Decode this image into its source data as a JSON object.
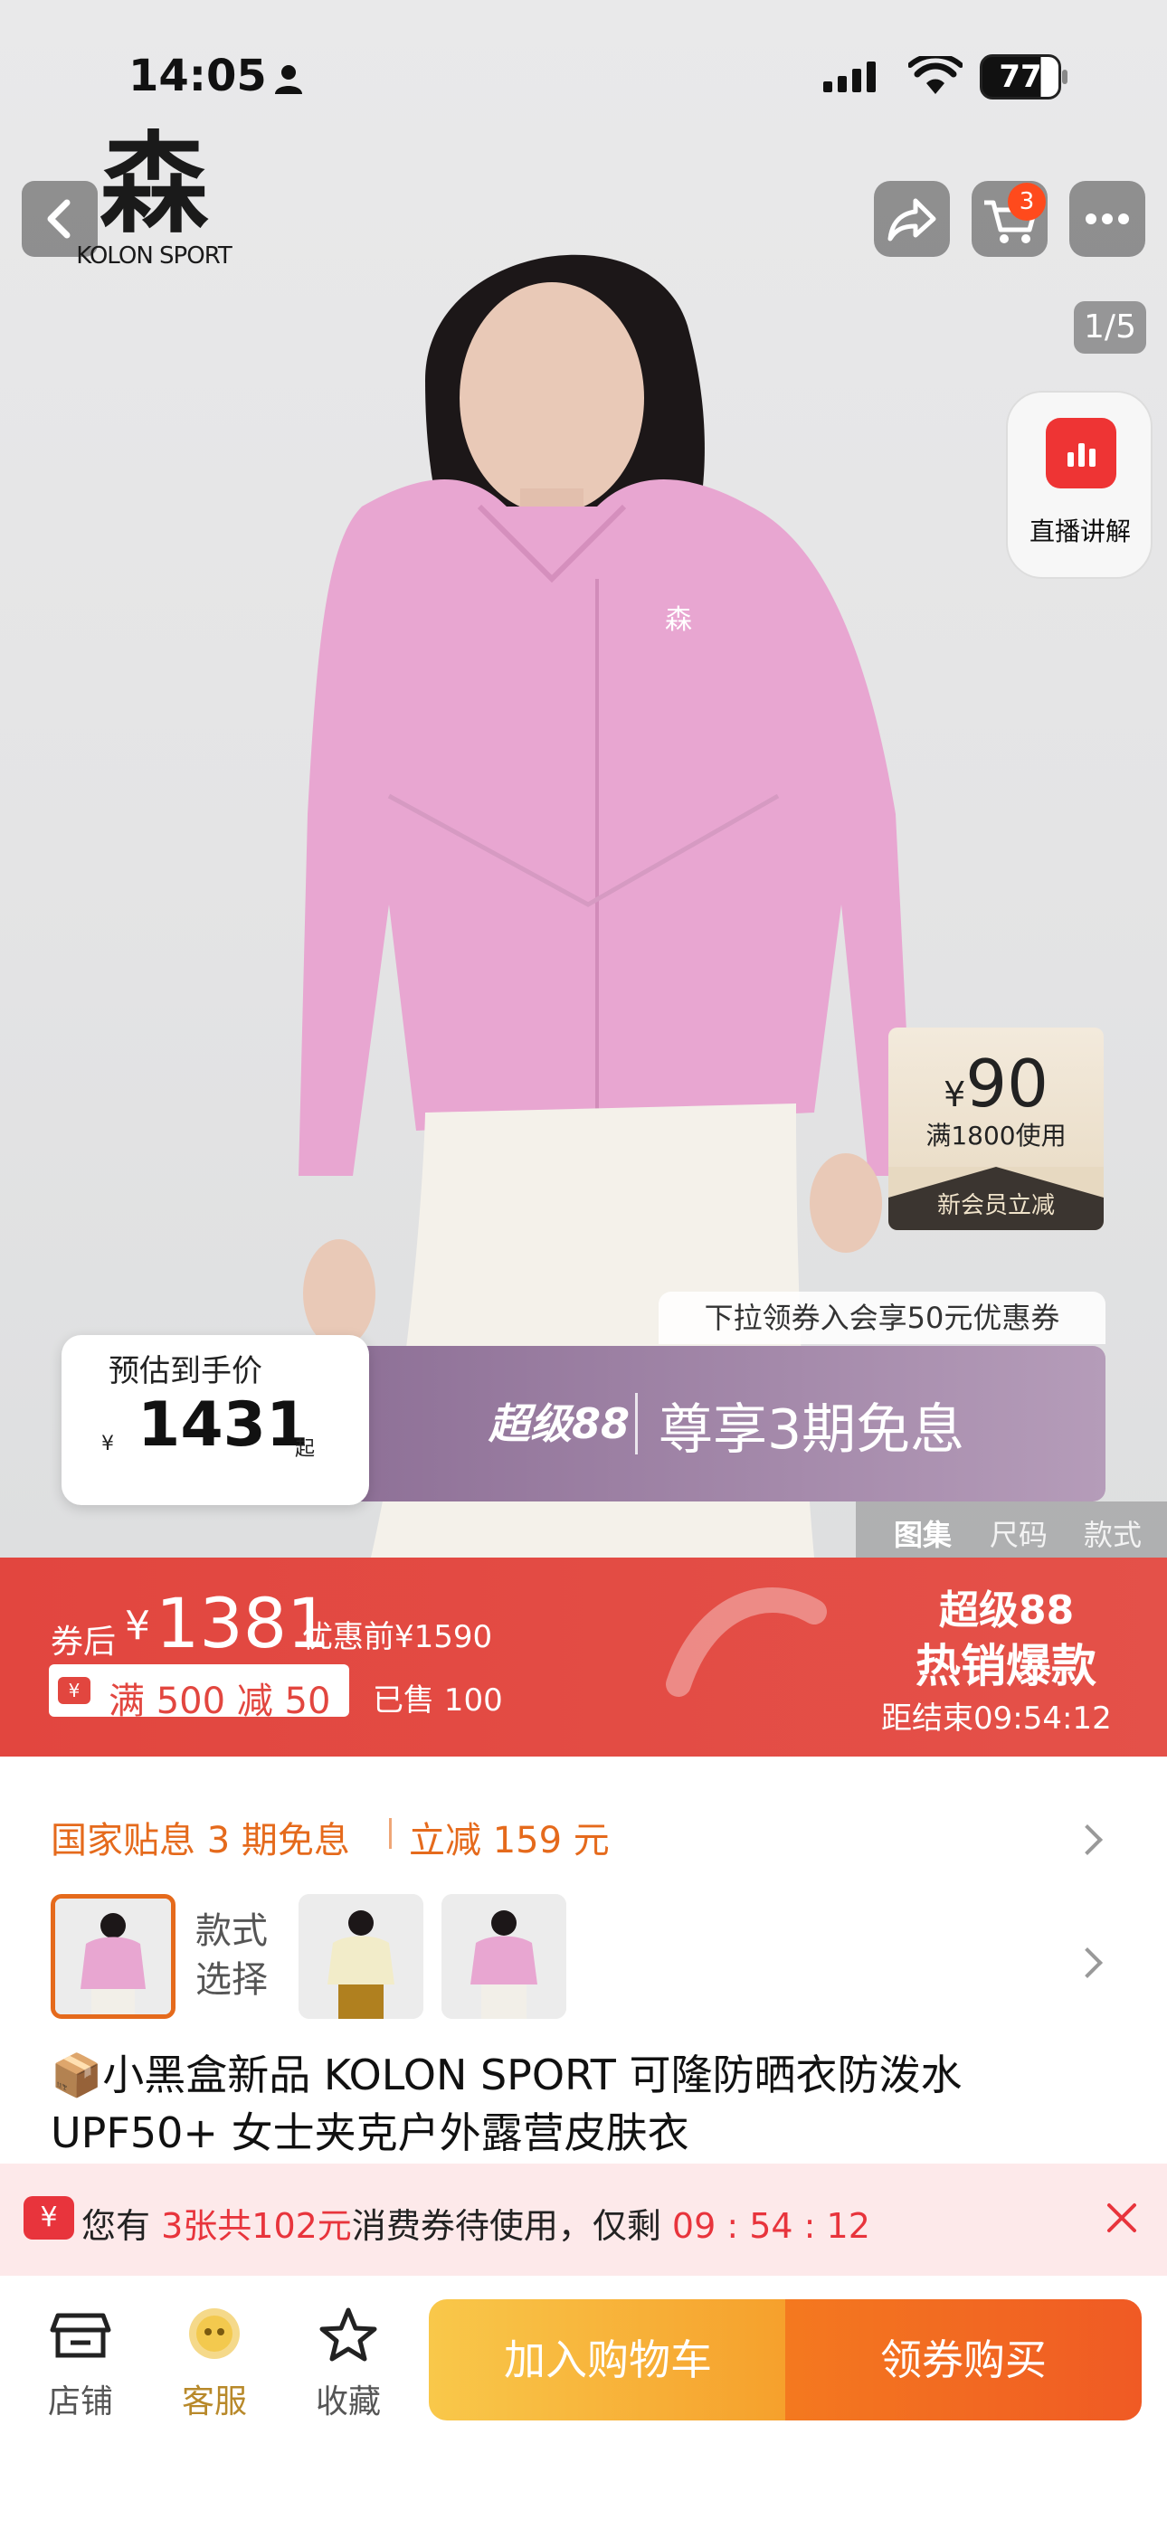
{
  "status_bar": {
    "time": "14:05",
    "battery": "77"
  },
  "brand": {
    "logo_mark": "森",
    "logo_text": "KOLON SPORT"
  },
  "header": {
    "cart_count": "3",
    "image_counter": "1/5"
  },
  "live": {
    "label": "直播讲解"
  },
  "member_coupon": {
    "symbol": "¥",
    "amount": "90",
    "condition": "满1800使用",
    "label": "新会员立减"
  },
  "price_banner": {
    "pull_hint": "下拉领券入会享50元优惠券",
    "estimate_label": "预估到手价",
    "currency": "¥",
    "estimate_value": "1431",
    "estimate_suffix": "起",
    "promo_brand": "超级88",
    "promo_text": "尊享3期免息"
  },
  "gallery_tabs": [
    "图集",
    "尺码",
    "款式"
  ],
  "promo": {
    "after_coupon_label": "券后",
    "currency": "¥",
    "price": "1381",
    "original": "优惠前¥1590",
    "coupon_icon": "¥",
    "coupon_text": "满 500 减 50",
    "sold": "已售 100",
    "event_line1": "超级88",
    "event_line2": "热销爆款",
    "countdown": "距结束09:54:12"
  },
  "subsidy": {
    "text1": "国家贴息 3 期免息",
    "text2": "立减 159 元"
  },
  "variants": {
    "label_line1": "款式",
    "label_line2": "选择"
  },
  "product": {
    "title": "📦小黑盒新品 KOLON SPORT 可隆防晒衣防泼水 UPF50+ 女士夹克户外露营皮肤衣"
  },
  "notice": {
    "icon": "¥",
    "text_prefix": "您有 ",
    "count": "3张共102元",
    "text_mid": "消费券待使用，仅剩 ",
    "timer": "09 : 54 : 12"
  },
  "bottom_bar": {
    "store": "店铺",
    "service": "客服",
    "favorite": "收藏",
    "add_cart": "加入购物车",
    "buy": "领券购买"
  }
}
